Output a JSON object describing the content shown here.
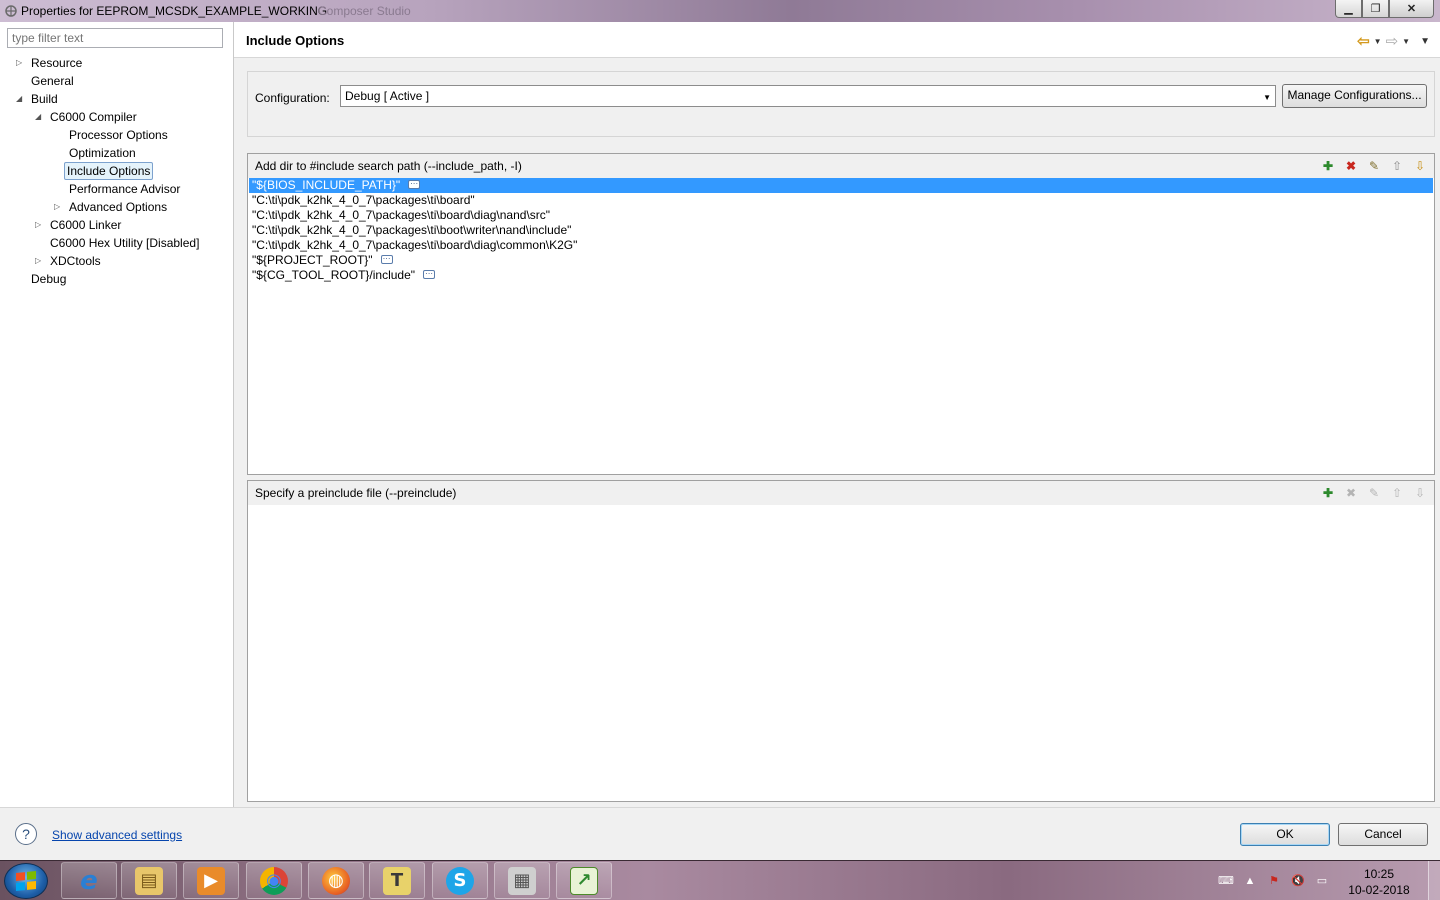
{
  "window": {
    "title": "Properties for EEPROM_MCSDK_EXAMPLE_WORKING",
    "title_ghost": "Composer Studio",
    "min_label": "▁",
    "max_label": "❐",
    "close_label": "✕"
  },
  "filter": {
    "placeholder": "type filter text"
  },
  "tree": [
    {
      "label": "Resource",
      "arrow": "▷"
    },
    {
      "label": "General",
      "arrow": ""
    },
    {
      "label": "Build",
      "arrow": "◢"
    },
    {
      "label": "C6000 Compiler",
      "arrow": "◢"
    },
    {
      "label": "Processor Options",
      "arrow": ""
    },
    {
      "label": "Optimization",
      "arrow": ""
    },
    {
      "label": "Include Options",
      "arrow": ""
    },
    {
      "label": "Performance Advisor",
      "arrow": ""
    },
    {
      "label": "Advanced Options",
      "arrow": "▷"
    },
    {
      "label": "C6000 Linker",
      "arrow": "▷"
    },
    {
      "label": "C6000 Hex Utility  [Disabled]",
      "arrow": ""
    },
    {
      "label": "XDCtools",
      "arrow": "▷"
    },
    {
      "label": "Debug",
      "arrow": ""
    }
  ],
  "page": {
    "title": "Include Options",
    "nav": {
      "back": "⇦",
      "forward": "⇨",
      "dropdown": "▼",
      "menu": "▼"
    }
  },
  "config": {
    "label": "Configuration:",
    "value": "Debug  [ Active ]",
    "caret": "▼",
    "manage_label": "Manage Configurations..."
  },
  "include_path": {
    "title": "Add dir to #include search path (--include_path, -I)",
    "icons": {
      "add": "✚",
      "delete": "✖",
      "edit": "✎",
      "up": "⇧",
      "down": "⇩"
    },
    "items": [
      "\"${BIOS_INCLUDE_PATH}\"",
      "\"C:\\ti\\pdk_k2hk_4_0_7\\packages\\ti\\board\"",
      "\"C:\\ti\\pdk_k2hk_4_0_7\\packages\\ti\\board\\diag\\nand\\src\"",
      "\"C:\\ti\\pdk_k2hk_4_0_7\\packages\\ti\\boot\\writer\\nand\\include\"",
      "\"C:\\ti\\pdk_k2hk_4_0_7\\packages\\ti\\board\\diag\\common\\K2G\"",
      "\"${PROJECT_ROOT}\"",
      "\"${CG_TOOL_ROOT}/include\""
    ],
    "more_glyph": "···"
  },
  "preinclude": {
    "title": "Specify a preinclude file (--preinclude)",
    "icons": {
      "add": "✚",
      "delete": "✖",
      "edit": "✎",
      "up": "⇧",
      "down": "⇩"
    }
  },
  "footer": {
    "help_glyph": "?",
    "advanced_link": "Show advanced settings",
    "ok_label": "OK",
    "cancel_label": "Cancel"
  },
  "taskbar": {
    "apps": [
      "internet-explorer",
      "file-explorer",
      "media-player",
      "chrome",
      "firefox",
      "text-editor",
      "skype",
      "virtual-box",
      "code-composer"
    ],
    "app_glyphs": [
      "e",
      "▤",
      "▶",
      "◉",
      "◍",
      "T",
      "S",
      "▦",
      "↗"
    ],
    "clock_time": "10:25",
    "clock_date": "10-02-2018",
    "tray_glyphs": [
      "⌨",
      "▲",
      "⚑",
      "🔇",
      "▭"
    ]
  },
  "colors": {
    "selection": "#3399ff",
    "link": "#0645ad",
    "accent_back_arrow": "#d49a1e"
  }
}
